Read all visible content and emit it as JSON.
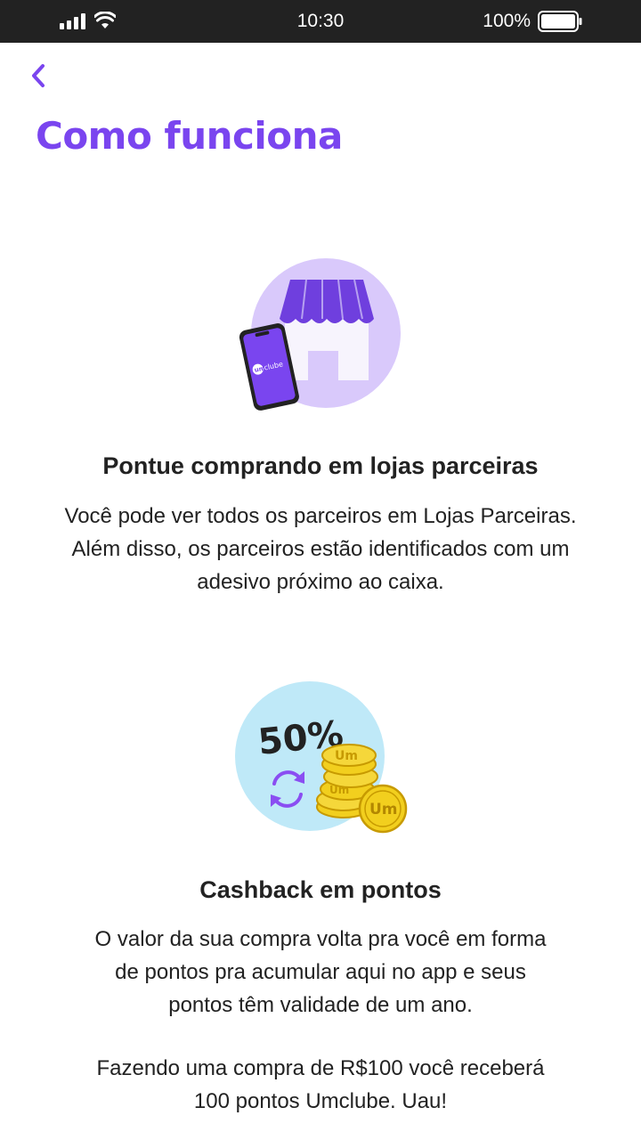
{
  "status_bar": {
    "time": "10:30",
    "battery": "100%",
    "icons": [
      "signal-icon",
      "wifi-icon",
      "battery-icon"
    ]
  },
  "header": {
    "back_icon": "chevron-left-icon",
    "title": "Como funciona"
  },
  "sections": [
    {
      "illustration": "store-phone-illustration",
      "phone_brand": "Umclube",
      "title": "Pontue comprando em lojas parceiras",
      "text_lines": [
        "Você pode ver todos os parceiros em Lojas Parceiras.",
        "Além disso, os parceiros estão identificados com um",
        "adesivo próximo ao caixa."
      ]
    },
    {
      "illustration": "cashback-coins-illustration",
      "badge": "50%",
      "coin_label": "Um",
      "title": "Cashback em pontos",
      "text_lines": [
        "O valor da sua compra volta pra você em forma",
        "de pontos pra acumular aqui no app e seus",
        "pontos têm validade de um ano."
      ],
      "text_lines_2": [
        "Fazendo uma compra de R$100 você receberá",
        "100 pontos Umclube. Uau!"
      ]
    }
  ],
  "colors": {
    "accent": "#7a45ef",
    "status_bar": "#222222",
    "store_circle": "#d9c9fb",
    "cash_circle": "#bfe9f8",
    "coin": "#f2cf1e"
  }
}
